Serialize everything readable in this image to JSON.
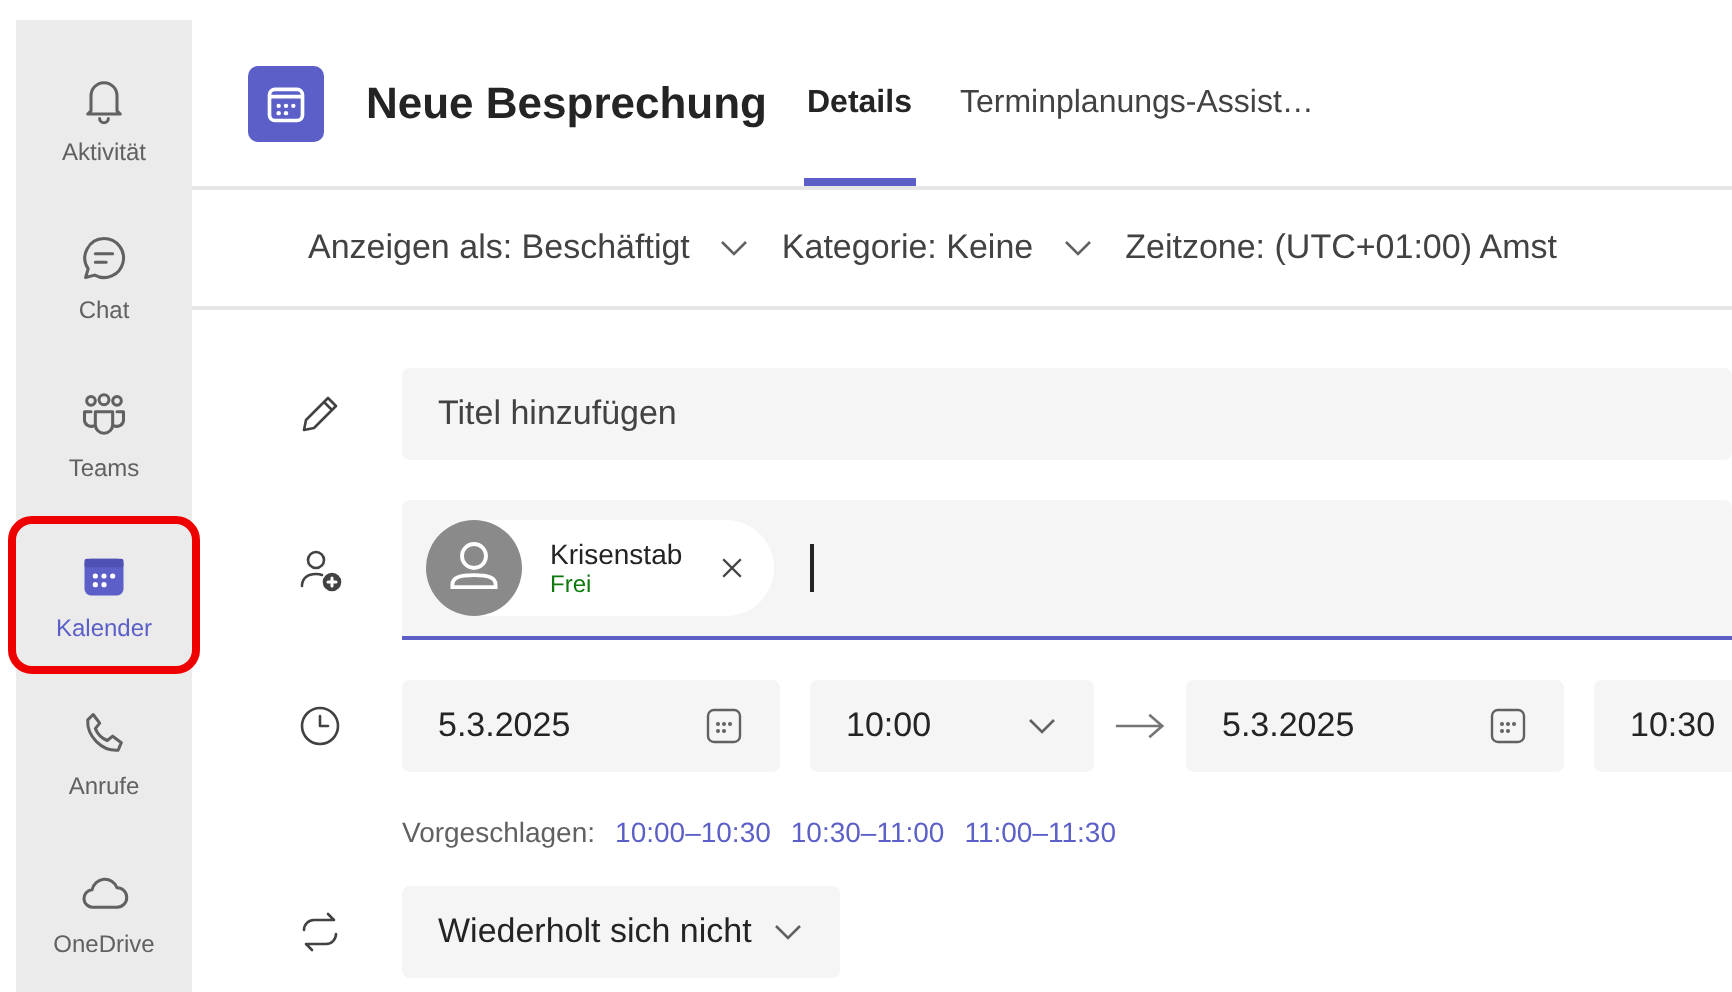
{
  "rail": {
    "items": [
      {
        "kind": "bell",
        "label": "Aktivität",
        "selected": false,
        "annotated": false
      },
      {
        "kind": "chat",
        "label": "Chat",
        "selected": false,
        "annotated": false
      },
      {
        "kind": "teams",
        "label": "Teams",
        "selected": false,
        "annotated": false
      },
      {
        "kind": "calendar",
        "label": "Kalender",
        "selected": true,
        "annotated": true
      },
      {
        "kind": "phone",
        "label": "Anrufe",
        "selected": false,
        "annotated": false
      },
      {
        "kind": "cloud",
        "label": "OneDrive",
        "selected": false,
        "annotated": false
      }
    ]
  },
  "header": {
    "title": "Neue Besprechung",
    "tabs": [
      {
        "label": "Details",
        "selected": true
      },
      {
        "label": "Terminplanungs-Assist…",
        "selected": false
      }
    ]
  },
  "toolbar": {
    "dropdowns": [
      "Anzeigen als: Beschäftigt",
      "Kategorie: Keine"
    ],
    "timezone": "Zeitzone: (UTC+01:00) Amst"
  },
  "form": {
    "title": {
      "placeholder": "Titel hinzufügen"
    },
    "attendees": {
      "focused": true,
      "chips": [
        {
          "name": "Krisenstab",
          "status": "Frei"
        }
      ]
    },
    "start": {
      "date": "5.3.2025",
      "time": "10:00"
    },
    "end": {
      "date": "5.3.2025",
      "time": "10:30"
    },
    "suggestions": {
      "label": "Vorgeschlagen:",
      "slots": [
        "10:00–10:30",
        "10:30–11:00",
        "11:00–11:30"
      ]
    },
    "repeat": "Wiederholt sich nicht"
  }
}
